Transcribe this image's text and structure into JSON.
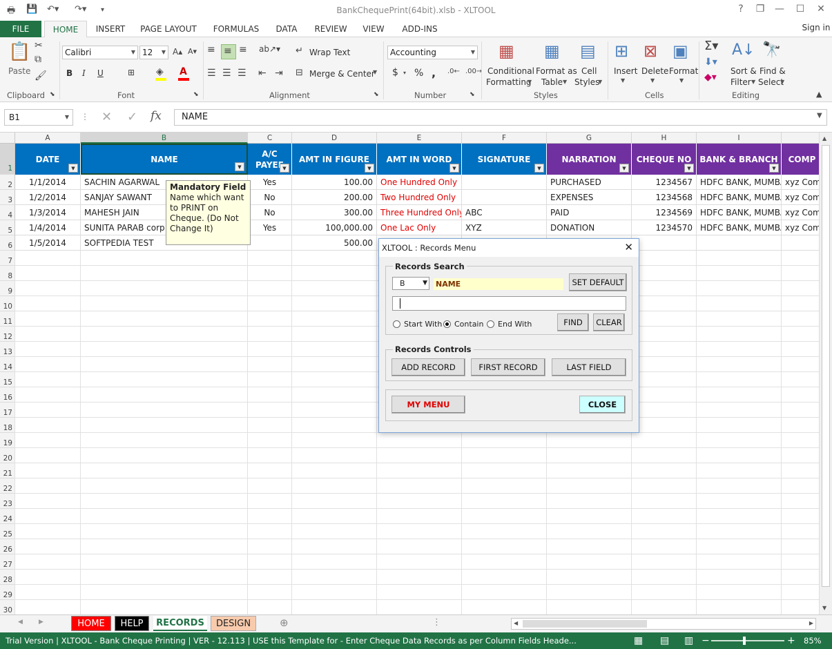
{
  "window": {
    "title": "BankChequePrint(64bit).xlsb - XLTOOL",
    "help": "?",
    "restore": "❐",
    "minimize": "—",
    "maximize": "☐",
    "close": "✕"
  },
  "account": {
    "signin": "Sign in"
  },
  "tabs": [
    "FILE",
    "HOME",
    "INSERT",
    "PAGE LAYOUT",
    "FORMULAS",
    "DATA",
    "REVIEW",
    "VIEW",
    "ADD-INS"
  ],
  "ribbon": {
    "clipboard": {
      "label": "Clipboard",
      "paste": "Paste"
    },
    "font": {
      "label": "Font",
      "name": "Calibri",
      "size": "12",
      "bold": "B",
      "italic": "I",
      "underline": "U"
    },
    "alignment": {
      "label": "Alignment",
      "wrap": "Wrap Text",
      "merge": "Merge & Center"
    },
    "number": {
      "label": "Number",
      "format": "Accounting",
      "currency": "$",
      "percent": "%",
      "comma": ","
    },
    "styles": {
      "label": "Styles",
      "cond1": "Conditional",
      "cond2": "Formatting",
      "fmt1": "Format as",
      "fmt2": "Table",
      "cell1": "Cell",
      "cell2": "Styles"
    },
    "cells": {
      "label": "Cells",
      "insert": "Insert",
      "delete": "Delete",
      "format": "Format"
    },
    "editing": {
      "label": "Editing",
      "sort1": "Sort &",
      "sort2": "Filter",
      "find1": "Find &",
      "find2": "Select"
    }
  },
  "formula": {
    "namebox": "B1",
    "fx": "fx",
    "value": "NAME"
  },
  "columns": [
    "A",
    "B",
    "C",
    "D",
    "E",
    "F",
    "G",
    "H",
    "I"
  ],
  "headers": [
    {
      "text": "DATE",
      "color": "#0070c0"
    },
    {
      "text": "NAME",
      "color": "#0070c0"
    },
    {
      "text": "A/C PAYEE",
      "color": "#0070c0"
    },
    {
      "text": "AMT IN FIGURE",
      "color": "#0070c0"
    },
    {
      "text": "AMT IN WORD",
      "color": "#0070c0"
    },
    {
      "text": "SIGNATURE",
      "color": "#0070c0"
    },
    {
      "text": "NARRATION",
      "color": "#7030a0"
    },
    {
      "text": "CHEQUE NO",
      "color": "#7030a0"
    },
    {
      "text": "BANK & BRANCH",
      "color": "#7030a0"
    },
    {
      "text": "COMP",
      "color": "#7030a0"
    }
  ],
  "rows": [
    [
      "1/1/2014",
      "SACHIN AGARWAL",
      "Yes",
      "100.00",
      "One Hundred  Only",
      "",
      "PURCHASED",
      "1234567",
      "HDFC BANK, MUMBA",
      "xyz Com"
    ],
    [
      "1/2/2014",
      "SANJAY SAWANT",
      "No",
      "200.00",
      "Two Hundred  Only",
      "",
      "EXPENSES",
      "1234568",
      "HDFC BANK, MUMBA",
      "xyz Com"
    ],
    [
      "1/3/2014",
      "MAHESH JAIN",
      "No",
      "300.00",
      "Three Hundred  Only",
      "ABC",
      "PAID",
      "1234569",
      "HDFC BANK, MUMBA",
      "xyz Com"
    ],
    [
      "1/4/2014",
      "SUNITA PARAB corp",
      "Yes",
      "100,000.00",
      "One Lac  Only",
      "XYZ",
      "DONATION",
      "1234570",
      "HDFC BANK, MUMBA",
      "xyz Com"
    ],
    [
      "1/5/2014",
      "SOFTPEDIA TEST",
      "",
      "500.00",
      "",
      "",
      "",
      "",
      "",
      ""
    ]
  ],
  "comment": {
    "title": "Mandatory Field",
    "body": "Name which want to PRINT on Cheque. (Do Not Change It)"
  },
  "dialog": {
    "title": "XLTOOL : Records Menu",
    "search_label": "Records Search",
    "col_select": "B",
    "col_name": "NAME",
    "set_default": "SET DEFAULT",
    "search_value": "",
    "start_with": "Start With",
    "contain": "Contain",
    "end_with": "End With",
    "find": "FIND",
    "clear": "CLEAR",
    "controls_label": "Records Controls",
    "add_record": "ADD RECORD",
    "first_record": "FIRST RECORD",
    "last_field": "LAST FIELD",
    "my_menu": "MY MENU",
    "close": "CLOSE"
  },
  "sheets": [
    {
      "name": "HOME",
      "bg": "#ff0000",
      "fg": "#ffffff"
    },
    {
      "name": "HELP",
      "bg": "#000000",
      "fg": "#ffffff"
    },
    {
      "name": "RECORDS",
      "bg": "#ffffff",
      "fg": "#217346"
    },
    {
      "name": "DESIGN",
      "bg": "#f8cbad",
      "fg": "#222222"
    }
  ],
  "status": {
    "text": "Trial Version  |  XLTOOL - Bank Cheque Printing  |  VER - 12.113  |  USE this Template for - Enter Cheque Data Records as per Column Fields Heade...",
    "zoom": "85%"
  }
}
